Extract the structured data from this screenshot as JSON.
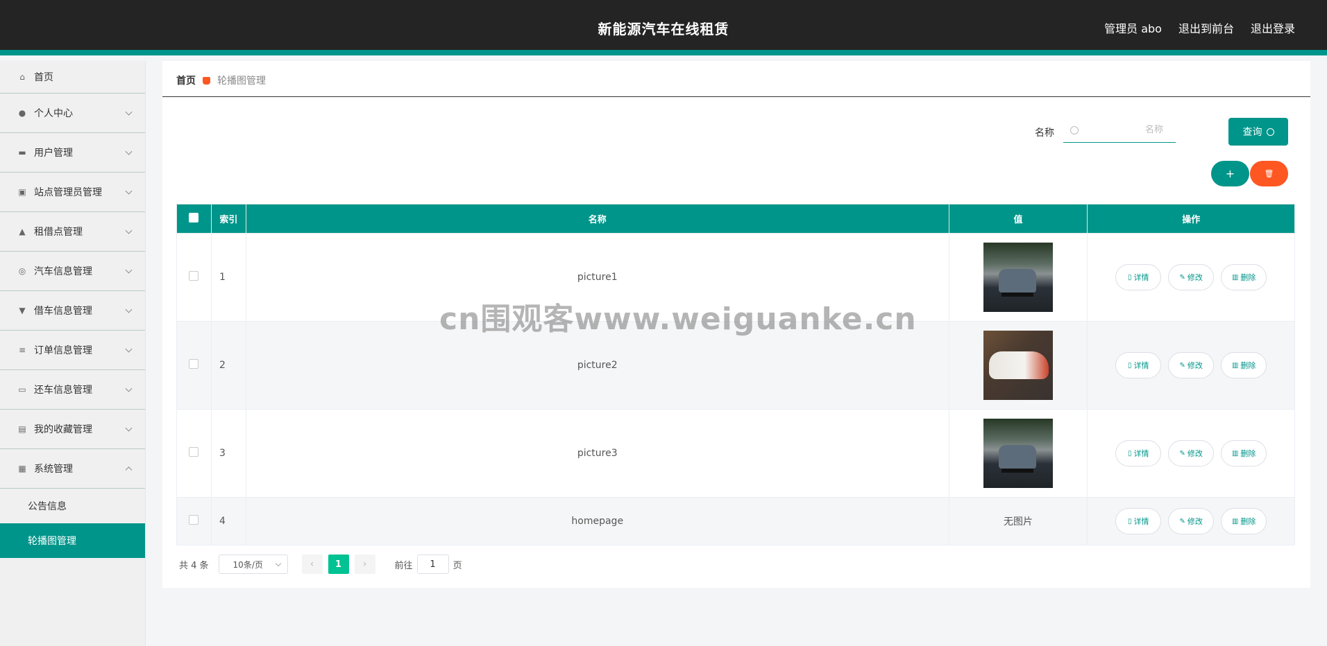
{
  "header": {
    "title": "新能源汽车在线租赁",
    "admin_label": "管理员 abo",
    "front_label": "退出到前台",
    "logout_label": "退出登录"
  },
  "sidebar": {
    "items": [
      {
        "label": "首页",
        "icon": "home-icon"
      },
      {
        "label": "个人中心",
        "icon": "user-icon"
      },
      {
        "label": "用户管理",
        "icon": "ticket-icon"
      },
      {
        "label": "站点管理员管理",
        "icon": "chart-icon"
      },
      {
        "label": "租借点管理",
        "icon": "person-icon"
      },
      {
        "label": "汽车信息管理",
        "icon": "gauge-icon"
      },
      {
        "label": "借车信息管理",
        "icon": "sign-icon"
      },
      {
        "label": "订单信息管理",
        "icon": "list-icon"
      },
      {
        "label": "还车信息管理",
        "icon": "monitor-icon"
      },
      {
        "label": "我的收藏管理",
        "icon": "clipboard-icon"
      },
      {
        "label": "系统管理",
        "icon": "settings-icon"
      }
    ],
    "sub_items": [
      {
        "label": "公告信息"
      },
      {
        "label": "轮播图管理"
      }
    ]
  },
  "breadcrumb": {
    "home": "首页",
    "current": "轮播图管理"
  },
  "search": {
    "label": "名称",
    "placeholder": "名称",
    "button": "查询"
  },
  "actions": {
    "add": "+",
    "delete": "🗑"
  },
  "table": {
    "columns": [
      "索引",
      "名称",
      "值",
      "操作"
    ],
    "rows": [
      {
        "index": "1",
        "name": "picture1",
        "value": "",
        "image": "car1"
      },
      {
        "index": "2",
        "name": "picture2",
        "value": "",
        "image": "car2"
      },
      {
        "index": "3",
        "name": "picture3",
        "value": "",
        "image": "car1"
      },
      {
        "index": "4",
        "name": "homepage",
        "value": "无图片",
        "image": ""
      }
    ],
    "ops": {
      "detail": "详情",
      "edit": "修改",
      "delete": "删除"
    }
  },
  "pagination": {
    "total": "共 4 条",
    "page_size": "10条/页",
    "current_page": "1",
    "goto_label": "前往",
    "goto_value": "1",
    "page_suffix": "页"
  },
  "watermark": "cn围观客www.weiguanke.cn",
  "colors": {
    "accent": "#00958a",
    "danger": "#ff5722",
    "header": "#242424"
  }
}
